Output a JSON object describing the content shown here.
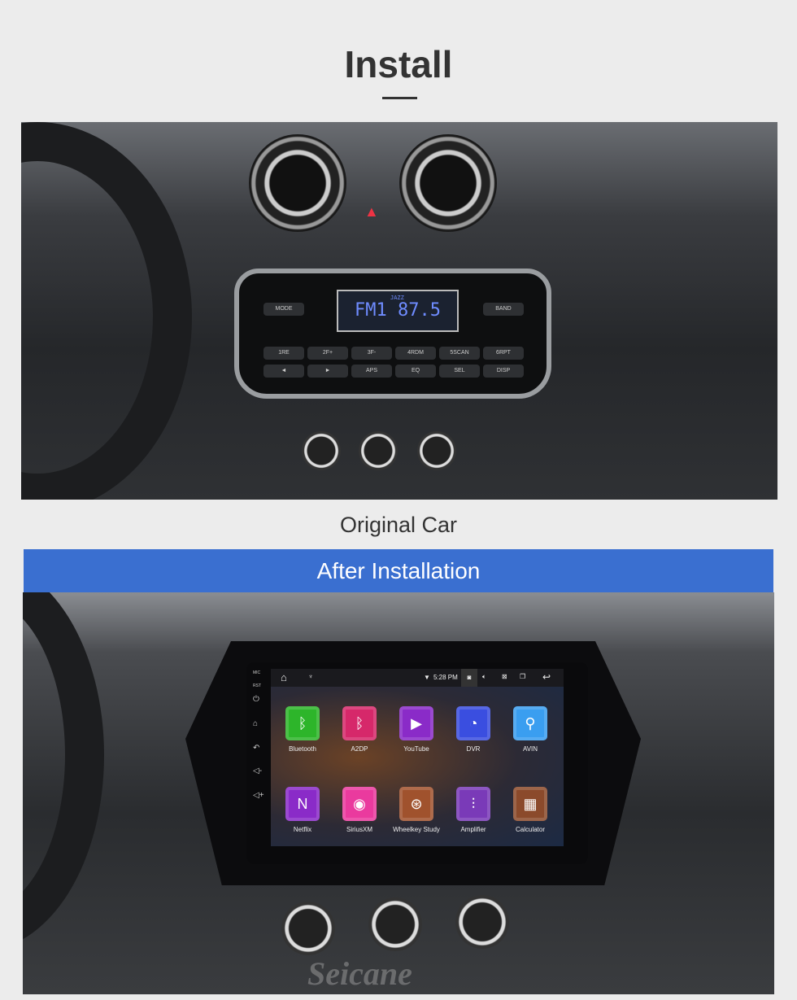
{
  "header": {
    "title": "Install"
  },
  "original": {
    "caption": "Original Car",
    "radio": {
      "display_band": "FM1",
      "display_freq": "87.5",
      "display_genre": "JAZZ",
      "mode_label": "MODE",
      "band_label": "BAND",
      "buttons": [
        "1RE",
        "2F+",
        "3F-",
        "4RDM",
        "5SCAN",
        "6RPT",
        "◄",
        "►",
        "APS",
        "EQ",
        "SEL",
        "DISP"
      ]
    }
  },
  "after": {
    "banner": "After  Installation",
    "status": {
      "time": "5:28 PM"
    },
    "apps": [
      {
        "label": "Bluetooth",
        "icon": "bluetooth-icon",
        "glyph": "ᛒ",
        "color": "#2db52a"
      },
      {
        "label": "A2DP",
        "icon": "bluetooth-icon",
        "glyph": "ᛒ",
        "color": "#d6286a"
      },
      {
        "label": "YouTube",
        "icon": "youtube-icon",
        "glyph": "▶",
        "color": "#8a2bc8"
      },
      {
        "label": "DVR",
        "icon": "gauge-icon",
        "glyph": "◔",
        "color": "#3a4ee0"
      },
      {
        "label": "AVIN",
        "icon": "avin-icon",
        "glyph": "⚲",
        "color": "#3a9ef0"
      },
      {
        "label": "Netflix",
        "icon": "netflix-icon",
        "glyph": "N",
        "color": "#8a2bc8"
      },
      {
        "label": "SiriusXM",
        "icon": "siriusxm-icon",
        "glyph": "◉",
        "color": "#ea3a9e"
      },
      {
        "label": "Wheelkey Study",
        "icon": "steering-wheel-icon",
        "glyph": "⊛",
        "color": "#a0522d"
      },
      {
        "label": "Amplifier",
        "icon": "equalizer-icon",
        "glyph": "⫶",
        "color": "#7a3ab8"
      },
      {
        "label": "Calculator",
        "icon": "calculator-icon",
        "glyph": "▦",
        "color": "#8b4a2b"
      }
    ],
    "side_labels": [
      "MIC",
      "RST"
    ]
  },
  "watermark": "Seicane",
  "colors": {
    "banner": "#3a6fd0",
    "background": "#ececec"
  }
}
